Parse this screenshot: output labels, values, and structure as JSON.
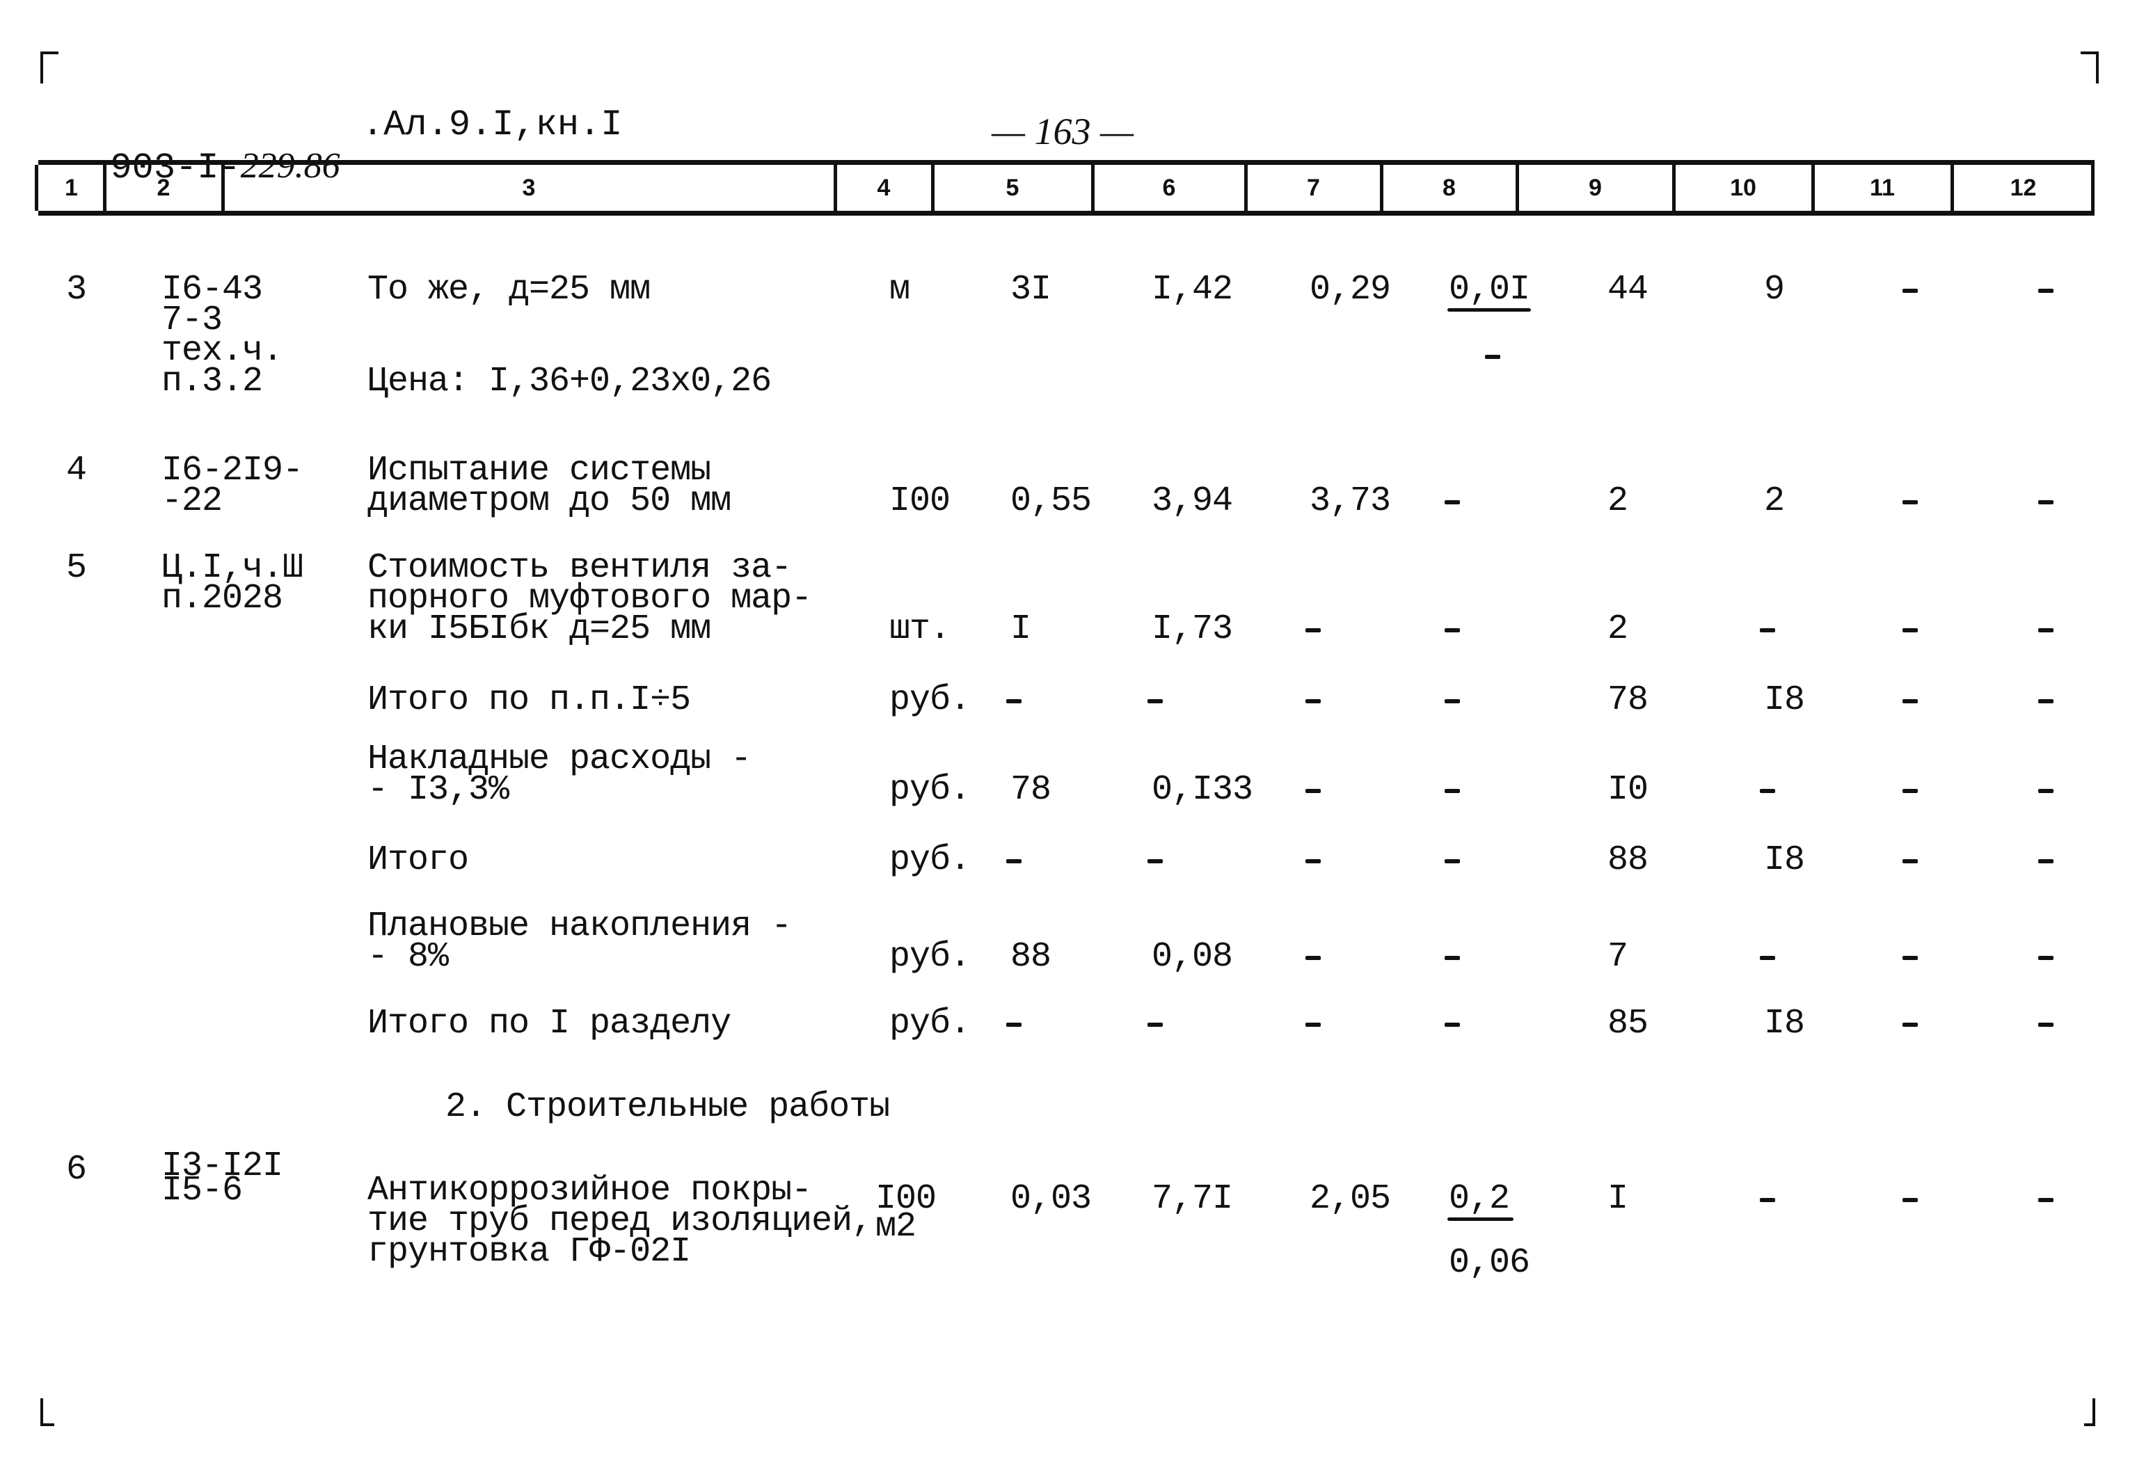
{
  "page": {
    "doc_code_prefix": "903-I-",
    "doc_code_handwritten": "229.86",
    "doc_ref": ".Ал.9.I,кн.I",
    "page_number": "— 163 —"
  },
  "column_headers": [
    "1",
    "2",
    "3",
    "4",
    "5",
    "6",
    "7",
    "8",
    "9",
    "10",
    "11",
    "12"
  ],
  "rows": [
    {
      "no": "3",
      "code": [
        "I6-43",
        "7-3",
        "тех.ч.",
        "п.3.2"
      ],
      "desc": [
        "То же, д=25 мм"
      ],
      "note": "Цена: I,36+0,23x0,26",
      "unit": "м",
      "c5": "3I",
      "c6": "I,42",
      "c7": "0,29",
      "c8_num": "0,0I",
      "c8_den": "-",
      "c9": "44",
      "c10": "9",
      "c11": "-",
      "c12": "-"
    },
    {
      "no": "4",
      "code": [
        "I6-2I9-",
        "-22"
      ],
      "desc": [
        "Испытание системы",
        "диаметром до 50 мм"
      ],
      "unit": "I00",
      "c5": "0,55",
      "c6": "3,94",
      "c7": "3,73",
      "c8": "-",
      "c9": "2",
      "c10": "2",
      "c11": "-",
      "c12": "-"
    },
    {
      "no": "5",
      "code": [
        "Ц.I,ч.Ш",
        "п.2028"
      ],
      "desc": [
        "Стоимость вентиля за-",
        "порного муфтового мар-",
        "ки I5БIбк д=25 мм"
      ],
      "unit": "шт.",
      "c5": "I",
      "c6": "I,73",
      "c7": "-",
      "c8": "-",
      "c9": "2",
      "c10": "-",
      "c11": "-",
      "c12": "-"
    }
  ],
  "summary_rows": [
    {
      "desc": [
        "Итого по п.п.I÷5"
      ],
      "unit": "руб.",
      "c5": "-",
      "c6": "-",
      "c7": "-",
      "c8": "-",
      "c9": "78",
      "c10": "I8",
      "c11": "-",
      "c12": "-"
    },
    {
      "desc": [
        "Накладные расходы -",
        "- I3,3%"
      ],
      "unit": "руб.",
      "c5": "78",
      "c6": "0,I33",
      "c7": "-",
      "c8": "-",
      "c9": "I0",
      "c10": "-",
      "c11": "-",
      "c12": "-"
    },
    {
      "desc": [
        "Итого"
      ],
      "unit": "руб.",
      "c5": "-",
      "c6": "-",
      "c7": "-",
      "c8": "-",
      "c9": "88",
      "c10": "I8",
      "c11": "-",
      "c12": "-"
    },
    {
      "desc": [
        "Плановые накопления -",
        "- 8%"
      ],
      "unit": "руб.",
      "c5": "88",
      "c6": "0,08",
      "c7": "-",
      "c8": "-",
      "c9": "7",
      "c10": "-",
      "c11": "-",
      "c12": "-"
    },
    {
      "desc": [
        "Итого по I разделу"
      ],
      "unit": "руб.",
      "c5": "-",
      "c6": "-",
      "c7": "-",
      "c8": "-",
      "c9": "85",
      "c10": "I8",
      "c11": "-",
      "c12": "-"
    }
  ],
  "section_title": "2. Строительные работы",
  "row6": {
    "no": "6",
    "code": [
      "I3-I2I",
      "I5-6"
    ],
    "desc": [
      "Антикоррозийное покры-",
      "тие труб перед изоляцией,",
      "грунтовка ГФ-02I"
    ],
    "unit": [
      "I00",
      "м2"
    ],
    "c5": "0,03",
    "c6": "7,7I",
    "c7": "2,05",
    "c8_num": "0,2",
    "c8_den": "0,06",
    "c9": "I",
    "c10": "-",
    "c11": "-",
    "c12": "-"
  }
}
